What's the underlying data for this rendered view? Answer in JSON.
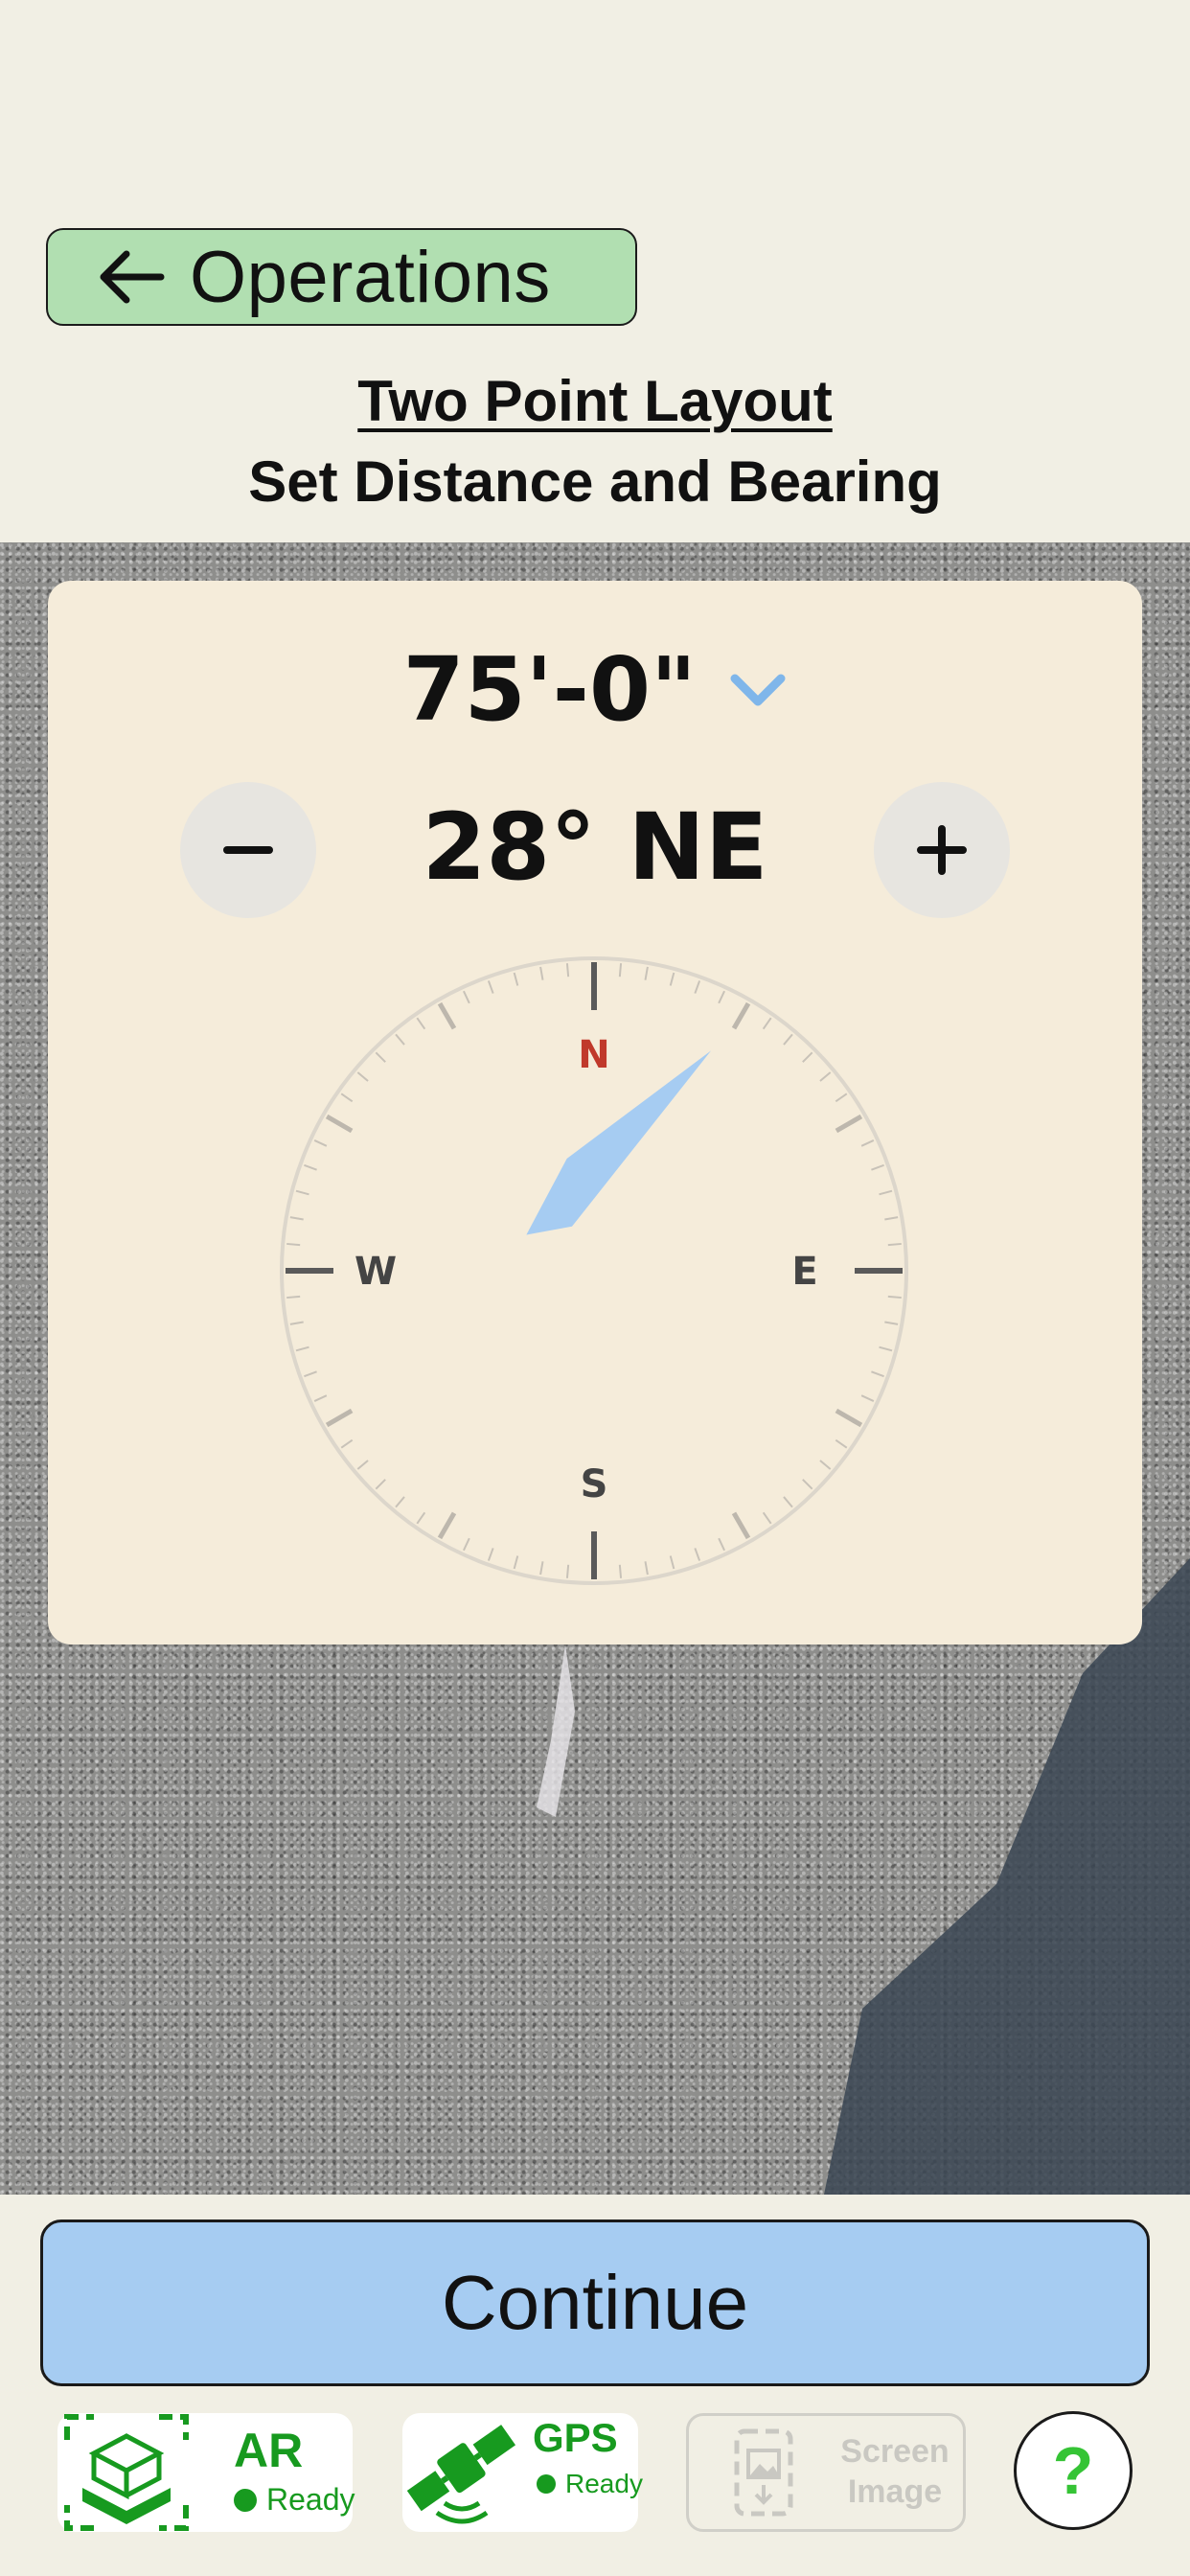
{
  "header": {
    "back_label": "Operations",
    "title": "Two Point Layout",
    "subtitle": "Set Distance and Bearing"
  },
  "card": {
    "distance": "75'-0\"",
    "bearing": "28° NE",
    "bearing_degrees": 28,
    "compass": {
      "north": "N",
      "south": "S",
      "east": "E",
      "west": "W"
    }
  },
  "actions": {
    "continue_label": "Continue"
  },
  "status": {
    "ar": {
      "title": "AR",
      "state": "Ready"
    },
    "gps": {
      "title": "GPS",
      "state": "Ready"
    },
    "screen_image": {
      "line1": "Screen",
      "line2": "Image"
    },
    "help_label": "?"
  },
  "colors": {
    "accent_green": "#179a1f",
    "back_button": "#b1dfb1",
    "continue_button": "#a6ccf2",
    "needle": "#a6ccf2",
    "north_label": "#c0392b"
  },
  "icons": [
    "back-arrow-icon",
    "chevron-down-icon",
    "minus-icon",
    "plus-icon",
    "ar-cube-icon",
    "satellite-icon",
    "screen-image-icon",
    "help-icon"
  ]
}
